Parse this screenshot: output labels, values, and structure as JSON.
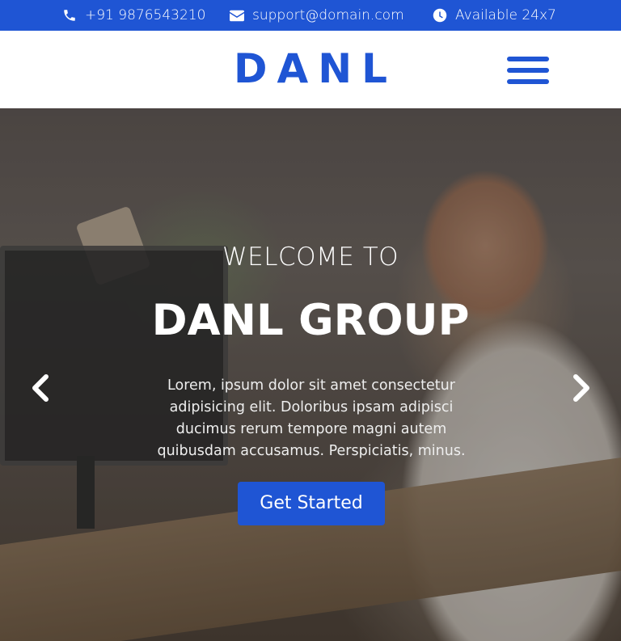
{
  "topbar": {
    "phone": "+91 9876543210",
    "email": "support@domain.com",
    "hours": "Available 24x7",
    "background": "#1f55d4"
  },
  "header": {
    "logo": "DANL",
    "menu_icon": "hamburger-menu-icon",
    "accent": "#1f55d4"
  },
  "hero": {
    "welcome": "WELCOME TO",
    "headline": "DANL GROUP",
    "lead": "Lorem, ipsum dolor sit amet consectetur adipisicing elit. Doloribus ipsam adipisci ducimus rerum tempore magni autem quibusdam accusamus. Perspiciatis, minus.",
    "cta_label": "Get Started",
    "prev_icon": "chevron-left-icon",
    "next_icon": "chevron-right-icon"
  }
}
